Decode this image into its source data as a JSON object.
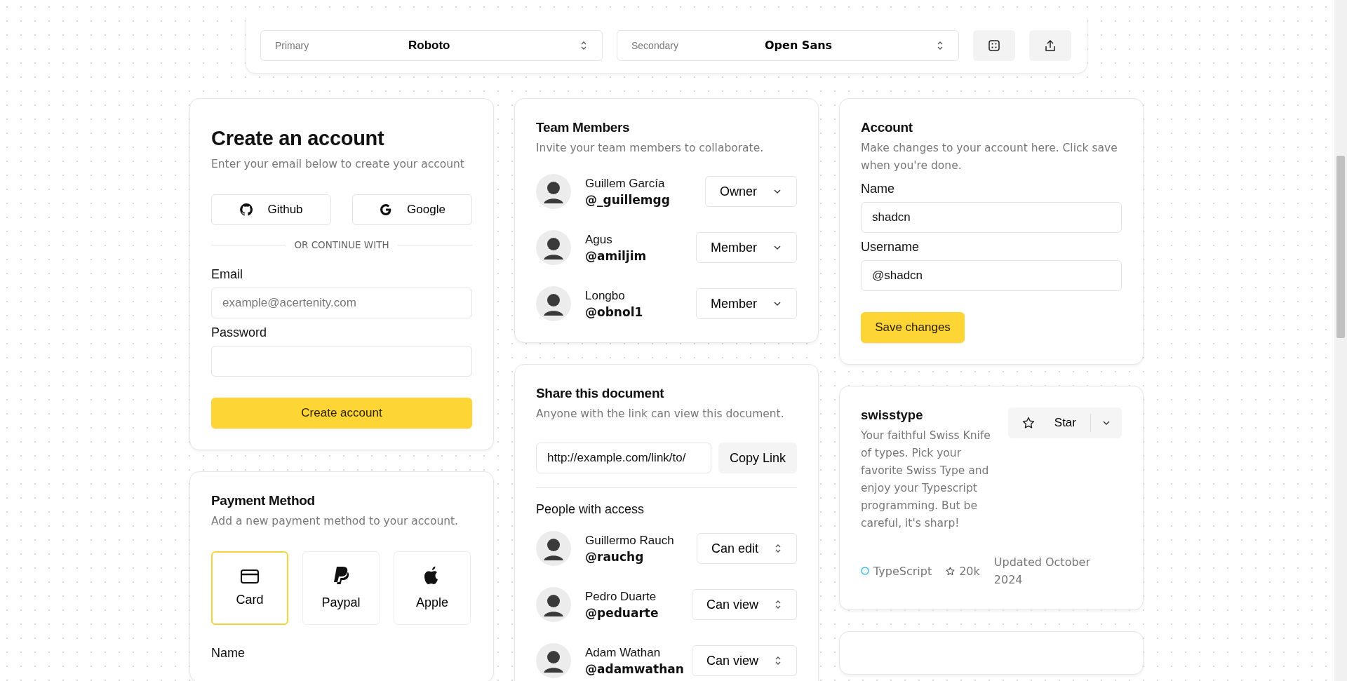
{
  "font_bar": {
    "selects": [
      {
        "label": "Primary",
        "value": "Roboto"
      },
      {
        "label": "Secondary",
        "value": "Open Sans"
      }
    ],
    "buttons": [
      {
        "kind": "dice"
      },
      {
        "kind": "share"
      }
    ]
  },
  "create_account": {
    "title": "Create an account",
    "description": "Enter your email below to create your account",
    "social_buttons": [
      {
        "kind": "github",
        "label": "Github"
      },
      {
        "kind": "google",
        "label": "Google"
      }
    ],
    "divider_text": "OR CONTINUE WITH",
    "fields": [
      {
        "label": "Email",
        "placeholder": "example@acertenity.com"
      },
      {
        "label": "Password"
      }
    ],
    "submit": "Create account"
  },
  "payment_method": {
    "title": "Payment Method",
    "description": "Add a new payment method to your account.",
    "options": [
      {
        "kind": "card",
        "label": "Card",
        "selected": true
      },
      {
        "kind": "paypal",
        "label": "Paypal",
        "selected": false
      },
      {
        "kind": "apple",
        "label": "Apple",
        "selected": false
      }
    ],
    "next_label": "Name"
  },
  "team_members": {
    "title": "Team Members",
    "description": "Invite your team members to collaborate.",
    "members": [
      {
        "name": "Guillem García",
        "handle": "@_guillemgg",
        "role": "Owner"
      },
      {
        "name": "Agus",
        "handle": "@amiljim",
        "role": "Member"
      },
      {
        "name": "Longbo",
        "handle": "@obnol1",
        "role": "Member"
      }
    ]
  },
  "share_document": {
    "title": "Share this document",
    "description": "Anyone with the link can view this document.",
    "link": "http://example.com/link/to/",
    "copy_button": "Copy Link",
    "access_title": "People with access",
    "people": [
      {
        "name": "Guillermo Rauch",
        "handle": "@rauchg",
        "permission": "Can edit"
      },
      {
        "name": "Pedro Duarte",
        "handle": "@peduarte",
        "permission": "Can view"
      },
      {
        "name": "Adam Wathan",
        "handle": "@adamwathan",
        "permission": "Can view"
      }
    ]
  },
  "account": {
    "title": "Account",
    "description": "Make changes to your account here. Click save when you're done.",
    "fields": [
      {
        "label": "Name",
        "value": "shadcn"
      },
      {
        "label": "Username",
        "value": "@shadcn"
      }
    ],
    "save_button": "Save changes"
  },
  "repo": {
    "name": "swisstype",
    "description": "Your faithful Swiss Knife of types. Pick your favorite Swiss Type and enjoy your Typescript programming. But be careful, it's sharp!",
    "star_button": "Star",
    "language": "TypeScript",
    "stars": "20k",
    "updated": "Updated October 2024"
  }
}
